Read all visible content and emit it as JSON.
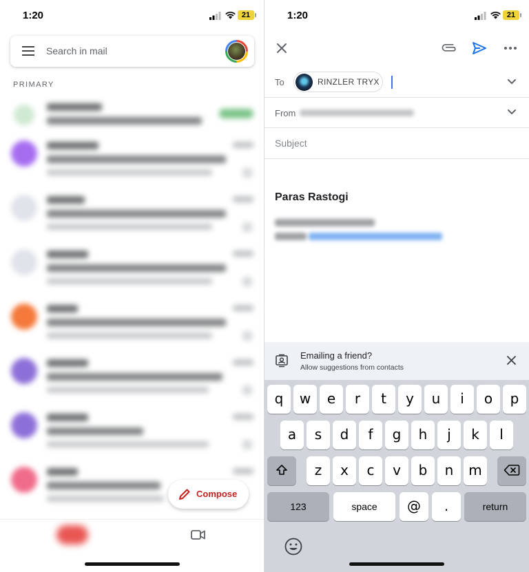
{
  "left_screen": {
    "status": {
      "time": "1:20",
      "battery": "21"
    },
    "search": {
      "placeholder": "Search in mail"
    },
    "section_label": "PRIMARY",
    "compose_label": "Compose"
  },
  "right_screen": {
    "status": {
      "time": "1:20",
      "battery": "21"
    },
    "to_label": "To",
    "recipient_name": "RINZLER TRYX",
    "from_label": "From",
    "subject_placeholder": "Subject",
    "signature_name": "Paras Rastogi",
    "suggestion": {
      "title": "Emailing a friend?",
      "subtitle": "Allow suggestions from contacts"
    },
    "keyboard": {
      "row1": [
        "q",
        "w",
        "e",
        "r",
        "t",
        "y",
        "u",
        "i",
        "o",
        "p"
      ],
      "row2": [
        "a",
        "s",
        "d",
        "f",
        "g",
        "h",
        "j",
        "k",
        "l"
      ],
      "row3": [
        "z",
        "x",
        "c",
        "v",
        "b",
        "n",
        "m"
      ],
      "numbers_label": "123",
      "space_label": "space",
      "at_label": "@",
      "period_label": ".",
      "return_label": "return"
    }
  },
  "icons": {
    "left": [
      "menu-icon",
      "avatar",
      "pencil-icon",
      "mail-icon",
      "video-icon"
    ],
    "right": [
      "close-icon",
      "attachment-icon",
      "send-icon",
      "more-icon",
      "chevron-down-icon",
      "contacts-icon",
      "shift-icon",
      "backspace-icon",
      "emoji-icon"
    ]
  },
  "colors": {
    "compose_red": "#c5221f",
    "send_blue": "#1a73e8",
    "keyboard_bg": "#d1d4da",
    "suggestion_bg": "#eef2f6"
  }
}
